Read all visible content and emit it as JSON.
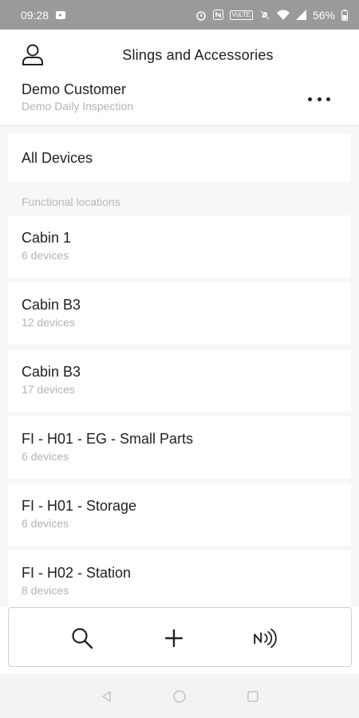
{
  "status_bar": {
    "time": "09:28",
    "battery": "56%",
    "volte": "VoLTE"
  },
  "header": {
    "title": "Slings and Accessories",
    "customer": "Demo Customer",
    "inspection": "Demo Daily Inspection"
  },
  "all_devices_label": "All Devices",
  "section_label": "Functional locations",
  "locations": [
    {
      "name": "Cabin 1",
      "count": "6 devices"
    },
    {
      "name": "Cabin B3",
      "count": "12 devices"
    },
    {
      "name": "Cabin B3",
      "count": "17 devices"
    },
    {
      "name": "FI - H01 - EG - Small Parts",
      "count": "6 devices"
    },
    {
      "name": "FI - H01 - Storage",
      "count": "6 devices"
    },
    {
      "name": "FI - H02 - Station",
      "count": "8 devices"
    }
  ],
  "toolbar": {
    "icons": [
      "search-icon",
      "plus-icon",
      "nfc-icon"
    ]
  }
}
